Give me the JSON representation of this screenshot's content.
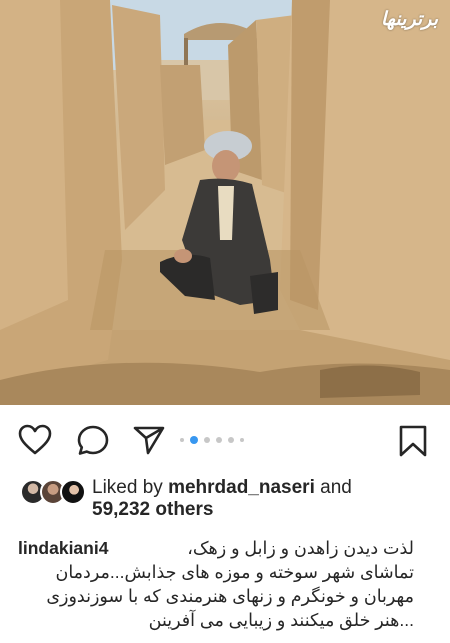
{
  "photo": {
    "watermark": "برترینها",
    "description_hidden": ""
  },
  "actions": {
    "like_icon": "heart-icon",
    "comment_icon": "comment-icon",
    "share_icon": "share-icon",
    "save_icon": "bookmark-icon",
    "carousel": {
      "count": 6,
      "active_index": 1
    },
    "accent_color": "#3897f0"
  },
  "likes": {
    "prefix": "Liked by",
    "user": "mehrdad_naseri",
    "conjunction": "and",
    "others": "59,232 others"
  },
  "caption": {
    "username": "lindakiani4",
    "lines": [
      "لذت دیدن زاهدن و زابل و زهک،",
      "تماشای شهر سوخته و  موزه های جذابش...مردمان",
      "مهربان و خونگرم و زنهای هنرمندی که با سوزندوزی",
      "...هنر خلق میکنند و زیبایی می آفرینن"
    ]
  }
}
